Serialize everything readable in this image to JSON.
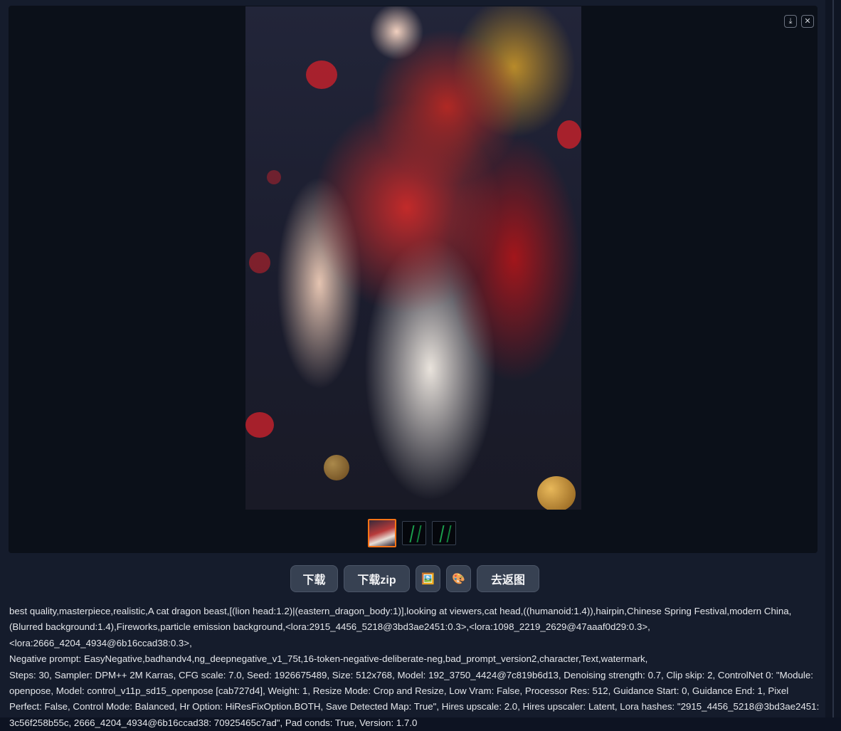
{
  "gallery": {
    "download_icon": "download-icon",
    "close_icon": "close-icon",
    "download_glyph": "⤓",
    "close_glyph": "✕",
    "thumbnails": [
      {
        "kind": "generated-image",
        "selected": true
      },
      {
        "kind": "openpose-map",
        "selected": false
      },
      {
        "kind": "openpose-map",
        "selected": false
      }
    ]
  },
  "buttons": {
    "download": "下载",
    "download_zip": "下载zip",
    "send_to_img_icon": "🖼️",
    "send_to_paint_icon": "🎨",
    "go_back": "去返图"
  },
  "generation_info": {
    "prompt": "best quality,masterpiece,realistic,A cat dragon beast,[(lion head:1.2)|(eastern_dragon_body:1)],looking at viewers,cat head,((humanoid:1.4)),hairpin,Chinese Spring Festival,modern China,(Blurred background:1.4),Fireworks,particle emission background,<lora:2915_4456_5218@3bd3ae2451:0.3>,<lora:1098_2219_2629@47aaaf0d29:0.3>,<lora:2666_4204_4934@6b16ccad38:0.3>,",
    "negative": "Negative prompt: EasyNegative,badhandv4,ng_deepnegative_v1_75t,16-token-negative-deliberate-neg,bad_prompt_version2,character,Text,watermark,",
    "params": "Steps: 30, Sampler: DPM++ 2M Karras, CFG scale: 7.0, Seed: 1926675489, Size: 512x768, Model: 192_3750_4424@7c819b6d13, Denoising strength: 0.7, Clip skip: 2, ControlNet 0: \"Module: openpose, Model: control_v11p_sd15_openpose [cab727d4], Weight: 1, Resize Mode: Crop and Resize, Low Vram: False, Processor Res: 512, Guidance Start: 0, Guidance End: 1, Pixel Perfect: False, Control Mode: Balanced, Hr Option: HiResFixOption.BOTH, Save Detected Map: True\", Hires upscale: 2.0, Hires upscaler: Latent, Lora hashes: \"2915_4456_5218@3bd3ae2451: 3c56f258b55c, 2666_4204_4934@6b16ccad38: 70925465c7ad\", Pad conds: True, Version: 1.7.0"
  }
}
